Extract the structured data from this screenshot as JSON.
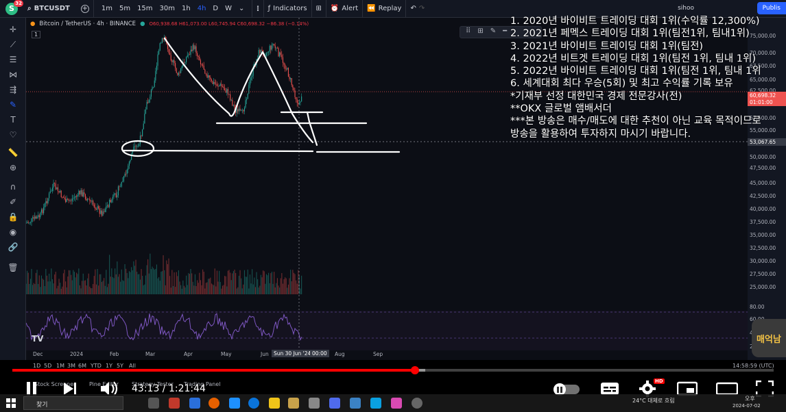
{
  "toolbar": {
    "logo_letter": "S",
    "logo_badge": "32",
    "symbol": "BTCUSDT",
    "timeframes": [
      "1m",
      "5m",
      "15m",
      "30m",
      "1h",
      "4h",
      "D",
      "W"
    ],
    "active_timeframe": "4h",
    "indicators_label": "Indicators",
    "alert_label": "Alert",
    "replay_label": "Replay",
    "user": "sihoo",
    "publish_label": "Publis"
  },
  "legend": {
    "pair": "Bitcoin / TetherUS · 4h · BINANCE",
    "ohlc": "O60,938.68 H61,073.00 L60,745.94 C60,698.32 −86.38 (−0.14%)",
    "sub": "1"
  },
  "price_axis": {
    "labels": [
      "75,000.00",
      "70,000.00",
      "67,500.00",
      "65,000.00",
      "62,500.00",
      "60,000.00",
      "57,500.00",
      "55,000.00",
      "53,067.65",
      "50,000.00",
      "47,500.00",
      "45,000.00",
      "42,500.00",
      "40,000.00",
      "37,500.00",
      "35,000.00",
      "32,500.00",
      "30,000.00",
      "27,500.00",
      "25,000.00"
    ],
    "current_price": "60,698.32",
    "countdown": "01:01:00",
    "crosshair_price": "53,067.65",
    "rsi_labels": [
      "80.00",
      "60.00",
      "40.00",
      "20.00"
    ]
  },
  "time_axis": {
    "labels": [
      "Dec",
      "2024",
      "Feb",
      "Mar",
      "Apr",
      "May",
      "Jun",
      "Aug",
      "Sep"
    ],
    "crosshair_time": "Sun 30 Jun '24",
    "crosshair_clock": "00:00"
  },
  "bottom_bar": {
    "ranges": [
      "1D",
      "5D",
      "1M",
      "3M",
      "6M",
      "YTD",
      "1Y",
      "5Y",
      "All"
    ],
    "tabs": [
      "Stock Screener",
      "Pine Editor",
      "Strategy Tester",
      "Trading Panel"
    ],
    "clock": "14:58:59 (UTC)"
  },
  "overlay_lines": [
    "1. 2020년 바이비트 트레이딩 대회 1위(수익률 12,300%)",
    "2. 2021년 페멕스 트레이딩 대회 1위(팀전1위, 팀내1위)",
    "3. 2021년 바이비트 트레이딩 대회 1위(팀전)",
    "4. 2022년 비트겟 트레이딩 대회 1위(팀전 1위, 팀내 1위)",
    "5. 2022년 바이비트 트레이딩 대회 1위(팀전 1위, 팀내 1위",
    "6. 세계대회 최다 우승(5회) 및 최고 수익률 기록 보유",
    "*기재부 선정 대한민국 경제 전문강사(전)",
    "**OKX 글로벌 앰배서더",
    "***본 방송은 매수/매도에 대한 추천이 아닌 교육 목적이므로",
    " 방송을 활용하여 투자하지 마시기 바랍니다."
  ],
  "watermark": "매억남",
  "player": {
    "current_time": "43:13",
    "duration": "1:21:44",
    "time_display": "43:13 / 1:21:44",
    "played_fraction": 0.5287,
    "buffered_fraction": 0.5423,
    "hd_badge": "HD"
  },
  "taskbar": {
    "search_placeholder": "찾기",
    "weather": "24°C 대체로 흐림",
    "time": "오후",
    "date": "2024-07-02"
  },
  "colors": {
    "bullish": "#26a69a",
    "bearish": "#ef5350",
    "accent": "#2962ff",
    "progress": "#ff0000",
    "rsi": "#7e57c2"
  }
}
